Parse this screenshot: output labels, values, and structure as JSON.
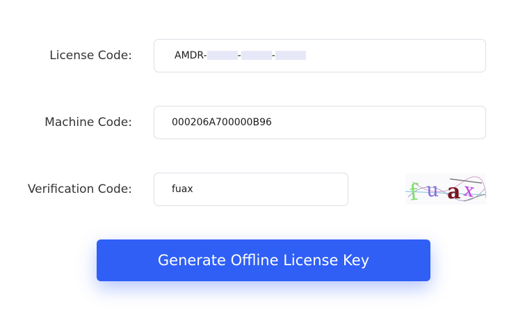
{
  "form": {
    "license_code": {
      "label": "License Code:",
      "value_prefix": "AMDR-",
      "separator": "-"
    },
    "machine_code": {
      "label": "Machine Code:",
      "value": "000206A700000B96"
    },
    "verification_code": {
      "label": "Verification Code:",
      "value": "fuax",
      "captcha_text": "fuax"
    }
  },
  "actions": {
    "generate_label": "Generate Offline License Key"
  },
  "colors": {
    "primary": "#2f5ff5",
    "border": "#dcdfe6",
    "label": "#333333",
    "redaction": "#e7e8f7"
  }
}
